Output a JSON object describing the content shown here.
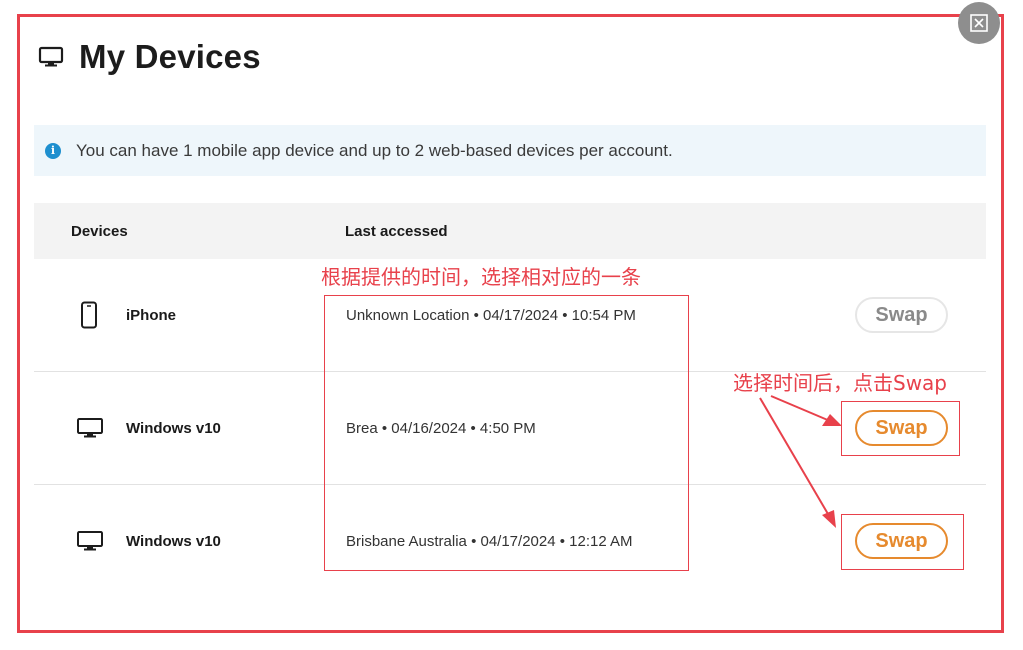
{
  "page": {
    "title": "My Devices",
    "close_icon": "close-icon"
  },
  "banner": {
    "text": "You can have 1 mobile app device and up to 2 web-based devices per account."
  },
  "table": {
    "headers": {
      "devices": "Devices",
      "last_accessed": "Last accessed"
    },
    "rows": [
      {
        "icon": "phone-icon",
        "device": "iPhone",
        "last_accessed": "Unknown Location • 04/17/2024 • 10:54 PM",
        "action": "Swap",
        "action_state": "disabled"
      },
      {
        "icon": "monitor-icon",
        "device": "Windows v10",
        "last_accessed": "Brea • 04/16/2024 • 4:50 PM",
        "action": "Swap",
        "action_state": "active"
      },
      {
        "icon": "monitor-icon",
        "device": "Windows v10",
        "last_accessed": "Brisbane Australia • 04/17/2024 • 12:12 AM",
        "action": "Swap",
        "action_state": "active"
      }
    ]
  },
  "annotations": {
    "choose_entry": "根据提供的时间，选择相对应的一条",
    "click_swap": "选择时间后，点击Swap"
  },
  "colors": {
    "annotation_red": "#e8414b",
    "swap_orange": "#e68a2e",
    "info_blue": "#1e8fcf",
    "banner_bg": "#eef6fb",
    "header_bg": "#f3f3f3"
  }
}
